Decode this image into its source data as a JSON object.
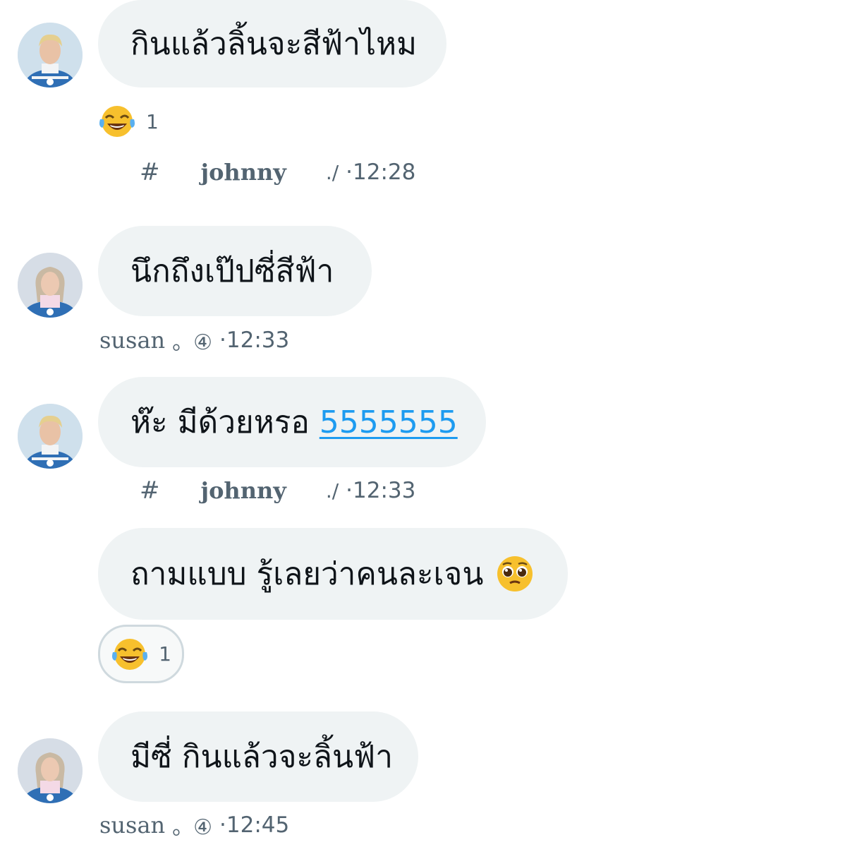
{
  "messages": [
    {
      "text": "กินแล้วลิ้นจะสีฟ้าไหม",
      "sender": "johnny",
      "reaction": {
        "emoji": "joy-emoji",
        "count": "1"
      },
      "meta": {
        "prefix": "#",
        "name": "johnny",
        "suffix": "./",
        "time": "·12:28"
      }
    },
    {
      "text": "นึกถึงเป๊ปซี่สีฟ้า",
      "sender": "susan",
      "meta": {
        "name": "susan",
        "suffix": "。④",
        "time": "·12:33"
      }
    },
    {
      "text": "ห๊ะ มีด้วยหรอ",
      "link": "5555555",
      "sender": "johnny",
      "meta": {
        "prefix": "#",
        "name": "johnny",
        "suffix": "./",
        "time": "·12:33"
      }
    },
    {
      "text": "ถามแบบ รู้เลยว่าคนละเจน",
      "emoji": "pleading-face-emoji",
      "sender": "johnny",
      "reaction": {
        "emoji": "joy-emoji",
        "count": "1"
      }
    },
    {
      "text": "มีซี่ กินแล้วจะลิ้นฟ้า",
      "sender": "susan",
      "meta": {
        "name": "susan",
        "suffix": "。④",
        "time": "·12:45"
      }
    }
  ],
  "colors": {
    "bubble": "#eff3f4",
    "meta_text": "#536471",
    "link": "#1d9bf0",
    "text": "#0f1419"
  }
}
